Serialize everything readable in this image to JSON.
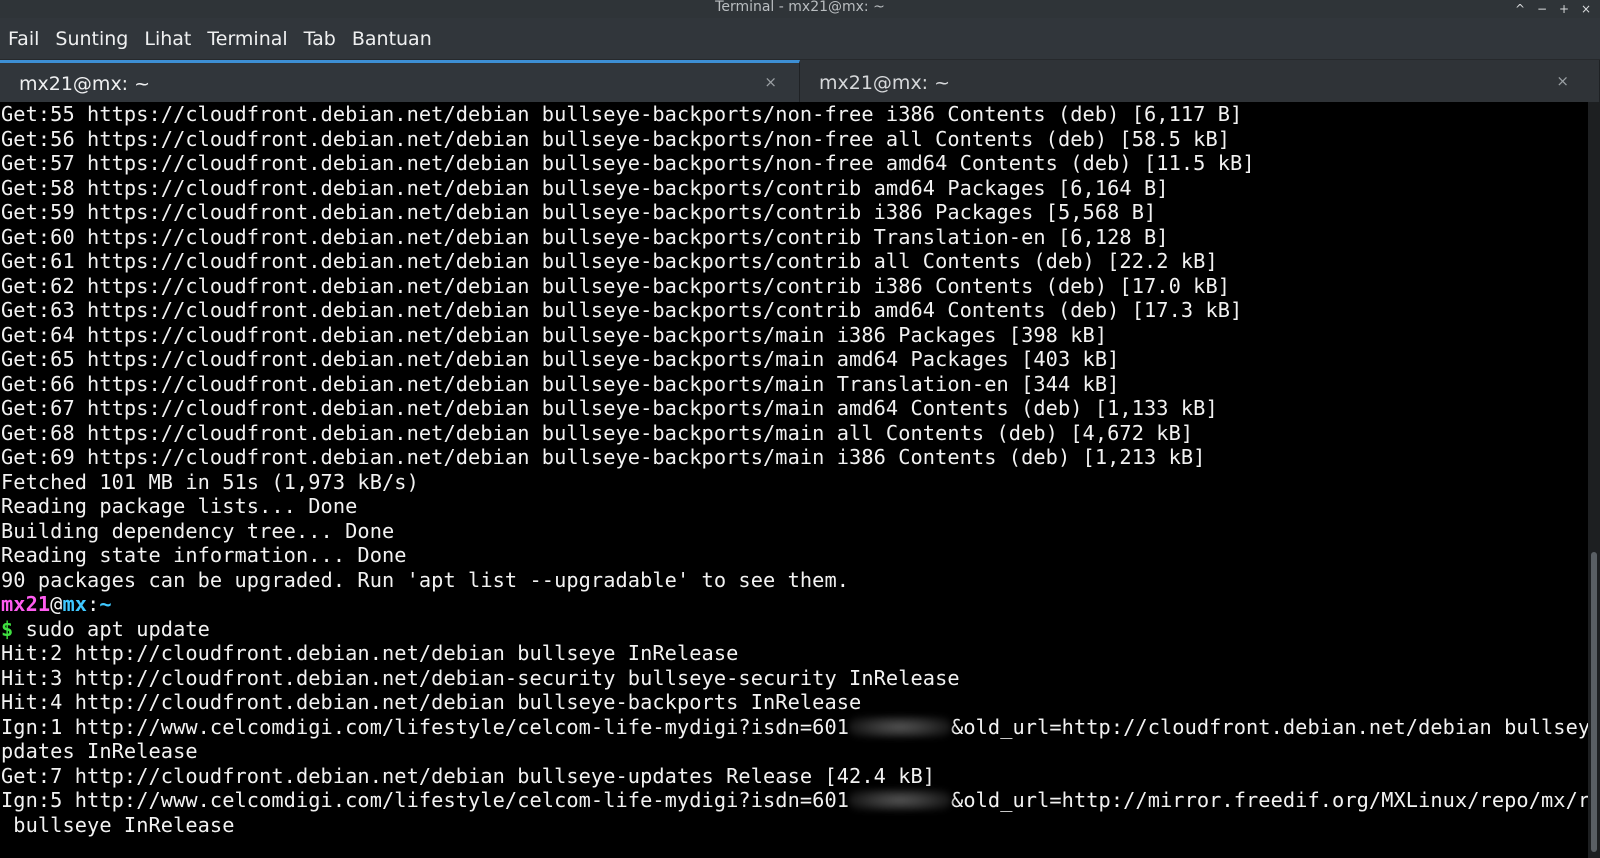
{
  "window": {
    "title": "Terminal - mx21@mx: ~",
    "controls": [
      "^",
      "−",
      "+",
      "×"
    ]
  },
  "menu": [
    "Fail",
    "Sunting",
    "Lihat",
    "Terminal",
    "Tab",
    "Bantuan"
  ],
  "tabs": [
    {
      "label": "mx21@mx: ~",
      "close": "×",
      "active": true
    },
    {
      "label": "mx21@mx: ~",
      "close": "×",
      "active": false
    }
  ],
  "terminal": {
    "lines": [
      "Get:55 https://cloudfront.debian.net/debian bullseye-backports/non-free i386 Contents (deb) [6,117 B]",
      "Get:56 https://cloudfront.debian.net/debian bullseye-backports/non-free all Contents (deb) [58.5 kB]",
      "Get:57 https://cloudfront.debian.net/debian bullseye-backports/non-free amd64 Contents (deb) [11.5 kB]",
      "Get:58 https://cloudfront.debian.net/debian bullseye-backports/contrib amd64 Packages [6,164 B]",
      "Get:59 https://cloudfront.debian.net/debian bullseye-backports/contrib i386 Packages [5,568 B]",
      "Get:60 https://cloudfront.debian.net/debian bullseye-backports/contrib Translation-en [6,128 B]",
      "Get:61 https://cloudfront.debian.net/debian bullseye-backports/contrib all Contents (deb) [22.2 kB]",
      "Get:62 https://cloudfront.debian.net/debian bullseye-backports/contrib i386 Contents (deb) [17.0 kB]",
      "Get:63 https://cloudfront.debian.net/debian bullseye-backports/contrib amd64 Contents (deb) [17.3 kB]",
      "Get:64 https://cloudfront.debian.net/debian bullseye-backports/main i386 Packages [398 kB]",
      "Get:65 https://cloudfront.debian.net/debian bullseye-backports/main amd64 Packages [403 kB]",
      "Get:66 https://cloudfront.debian.net/debian bullseye-backports/main Translation-en [344 kB]",
      "Get:67 https://cloudfront.debian.net/debian bullseye-backports/main amd64 Contents (deb) [1,133 kB]",
      "Get:68 https://cloudfront.debian.net/debian bullseye-backports/main all Contents (deb) [4,672 kB]",
      "Get:69 https://cloudfront.debian.net/debian bullseye-backports/main i386 Contents (deb) [1,213 kB]",
      "Fetched 101 MB in 51s (1,973 kB/s)",
      "Reading package lists... Done",
      "Building dependency tree... Done",
      "Reading state information... Done",
      "90 packages can be upgraded. Run 'apt list --upgradable' to see them."
    ],
    "prompt": {
      "user": "mx21",
      "at": "@",
      "host": "mx",
      "colon": ":",
      "path": "~",
      "dollar": "$",
      "command": " sudo apt update"
    },
    "after_lines": [
      "Hit:2 http://cloudfront.debian.net/debian bullseye InRelease",
      "Hit:3 http://cloudfront.debian.net/debian-security bullseye-security InRelease",
      "Hit:4 http://cloudfront.debian.net/debian bullseye-backports InRelease"
    ],
    "ign1": {
      "before": "Ign:1 http://www.celcomdigi.com/lifestyle/celcom-life-mydigi?isdn=601",
      "after": "&old_url=http://cloudfront.debian.net/debian bullseye-u",
      "wrap": "pdates InRelease"
    },
    "get7": "Get:7 http://cloudfront.debian.net/debian bullseye-updates Release [42.4 kB]",
    "ign5": {
      "before": "Ign:5 http://www.celcomdigi.com/lifestyle/celcom-life-mydigi?isdn=601",
      "after": "&old_url=http://mirror.freedif.org/MXLinux/repo/mx/repo",
      "wrap": " bullseye InRelease"
    }
  }
}
